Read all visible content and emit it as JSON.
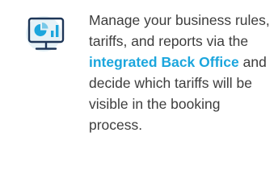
{
  "feature": {
    "icon": "monitor-chart-icon",
    "text_before": "Manage your business rules, tariffs, and reports via the ",
    "highlight": "integrated Back Office",
    "text_after": " and decide which tariffs will be visible in the booking process."
  },
  "colors": {
    "icon_circle": "#e6f2f7",
    "icon_stroke": "#1d3557",
    "icon_accent": "#1ca6dd",
    "highlight": "#1ca6dd",
    "text": "#3d3d3d"
  }
}
